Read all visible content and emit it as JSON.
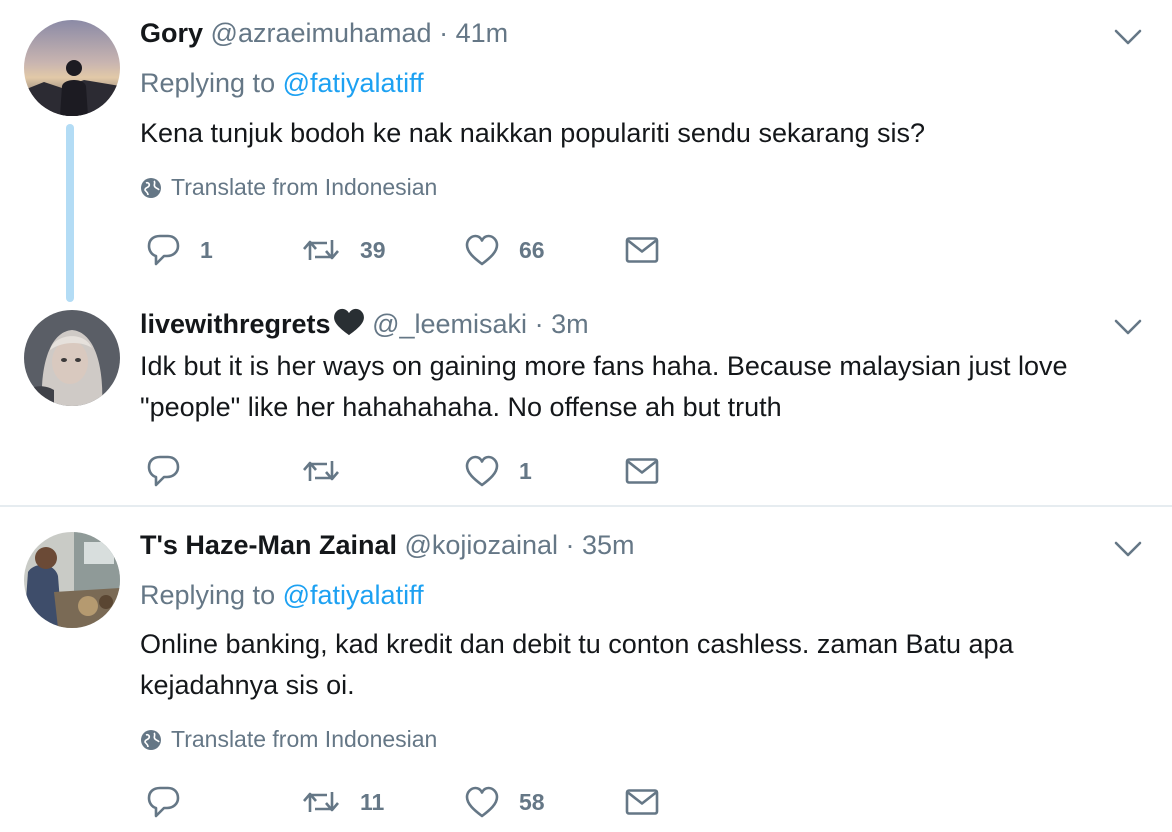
{
  "tweets": [
    {
      "name": "Gory",
      "handle": "@azraeimuhamad",
      "separator": "·",
      "time": "41m",
      "replying_prefix": "Replying to",
      "replying_to": "@fatiyalatiff",
      "text": "Kena tunjuk bodoh ke nak naikkan populariti sendu sekarang sis?",
      "translate": "Translate from Indonesian",
      "replies": "1",
      "retweets": "39",
      "likes": "66"
    },
    {
      "name": "livewithregrets",
      "handle": "@_leemisaki",
      "separator": "·",
      "time": "3m",
      "text": "Idk but it is her ways on gaining more fans haha. Because malaysian just love \"people\" like her hahahahaha. No offense ah but truth",
      "replies": "",
      "retweets": "",
      "likes": "1"
    },
    {
      "name": "T's Haze-Man Zainal",
      "handle": "@kojiozainal",
      "separator": "·",
      "time": "35m",
      "replying_prefix": "Replying to",
      "replying_to": "@fatiyalatiff",
      "text": "Online banking, kad kredit dan debit tu conton cashless. zaman Batu apa kejadahnya sis oi.",
      "translate": "Translate from Indonesian",
      "replies": "",
      "retweets": "11",
      "likes": "58"
    }
  ],
  "icons": {
    "reply": "reply-icon",
    "retweet": "retweet-icon",
    "like": "heart-icon",
    "message": "envelope-icon",
    "globe": "globe-icon",
    "menu": "chevron-down-icon",
    "name_emoji": "black-heart-icon"
  },
  "colors": {
    "link": "#1da1f2",
    "secondary": "#657786",
    "thread_line": "#b3dcf5",
    "text": "#14171a"
  }
}
